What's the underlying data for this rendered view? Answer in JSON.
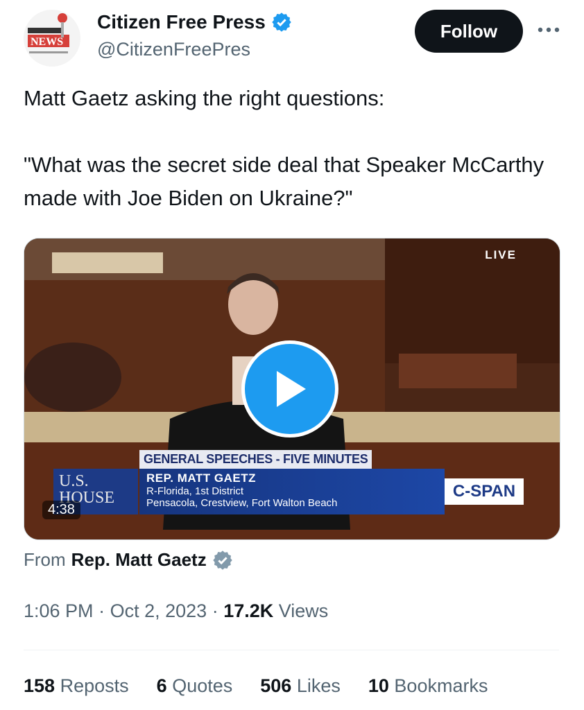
{
  "profile": {
    "display_name": "Citizen Free Press",
    "handle": "@CitizenFreePres",
    "verified_icon": "verified-badge-icon",
    "avatar_text": "NEWS"
  },
  "actions": {
    "follow_label": "Follow",
    "more_icon": "more-icon"
  },
  "tweet": {
    "line1": "Matt Gaetz asking the right questions:",
    "line2": "\"What was the secret side deal that Speaker McCarthy made with Joe Biden on Ukraine?\""
  },
  "media": {
    "live_label": "LIVE",
    "duration": "4:38",
    "chyron_title": "GENERAL SPEECHES - FIVE MINUTES",
    "chyron_name": "REP. MATT GAETZ",
    "chyron_district": "R-Florida, 1st District",
    "chyron_towns": "Pensacola, Crestview, Fort Walton Beach",
    "house_logo_line1": "U.S.",
    "house_logo_line2": "HOUSE",
    "network_logo": "C-SPAN"
  },
  "source": {
    "from_label": "From",
    "from_name": "Rep. Matt Gaetz"
  },
  "meta": {
    "time": "1:06 PM",
    "date": "Oct 2, 2023",
    "views_count": "17.2K",
    "views_label": "Views"
  },
  "stats": {
    "reposts_count": "158",
    "reposts_label": "Reposts",
    "quotes_count": "6",
    "quotes_label": "Quotes",
    "likes_count": "506",
    "likes_label": "Likes",
    "bookmarks_count": "10",
    "bookmarks_label": "Bookmarks"
  },
  "colors": {
    "accent": "#1d9bf0",
    "text_primary": "#0f1419",
    "text_secondary": "#536471",
    "source_verified": "#829aab"
  }
}
